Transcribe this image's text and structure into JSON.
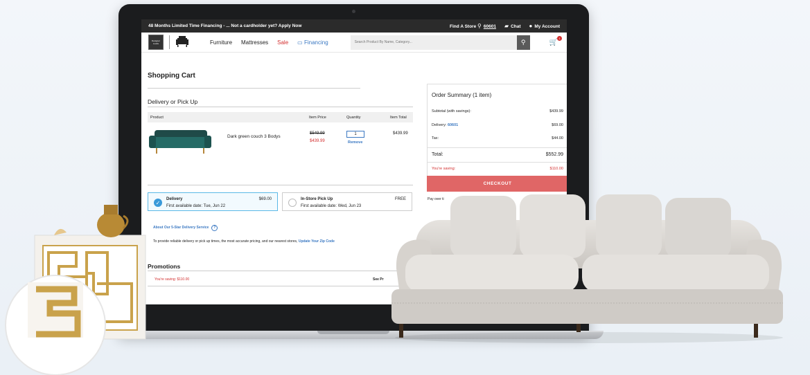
{
  "topbar": {
    "promo": "48 Months Limited Time Financing - ... Not a cardholder yet? Apply Now",
    "find_store": "Find A Store",
    "zip": "60601",
    "chat": "Chat",
    "account": "My Account"
  },
  "nav": {
    "logo_text": "Designer Looks",
    "links": [
      "Furniture",
      "Mattresses",
      "Sale",
      "Financing"
    ],
    "search_placeholder": "Search Product By Name, Category...",
    "cart_count": "1"
  },
  "page": {
    "title": "Shopping Cart",
    "section": "Delivery or Pick Up"
  },
  "table": {
    "headers": [
      "Product",
      "Item Price",
      "Quantity",
      "Item Total"
    ],
    "item": {
      "name": "Dark green couch 3 Bodys",
      "price_old": "$549.99",
      "price_new": "$439.99",
      "quantity": "1",
      "remove": "Remove",
      "total": "$439.99"
    }
  },
  "options": {
    "delivery": {
      "title": "Delivery",
      "date": "First available date: Tue, Jun 22",
      "price": "$69.00"
    },
    "pickup": {
      "title": "In-Store Pick Up",
      "date": "First available date: Wed, Jun 23",
      "price": "FREE"
    }
  },
  "about_link": "About Our 5-Star Delivery Service",
  "info_text": "To provide reliable delivery or pick up times, the most accurate pricing, and our nearest stores,",
  "info_link": "Update Your Zip Code",
  "promotions": {
    "title": "Promotions",
    "saving": "You're saving: $110.00",
    "see": "See Pr"
  },
  "summary": {
    "title": "Order Summary (1 item)",
    "subtotal_label": "Subtotal (with savings):",
    "subtotal": "$439.99",
    "delivery_label": "Delivery:",
    "delivery_zip": "60601",
    "delivery": "$69.00",
    "tax_label": "Tax:",
    "tax": "$44.00",
    "total_label": "Total:",
    "total": "$552.99",
    "saving_label": "You're saving:",
    "saving": "$110.00",
    "checkout": "CHECKOUT",
    "pay_over": "Pay over ti"
  },
  "colors": {
    "sale": "#d32f2f",
    "link": "#3a78c2",
    "checkout": "#e06666",
    "topbar": "#2b2b2b"
  }
}
